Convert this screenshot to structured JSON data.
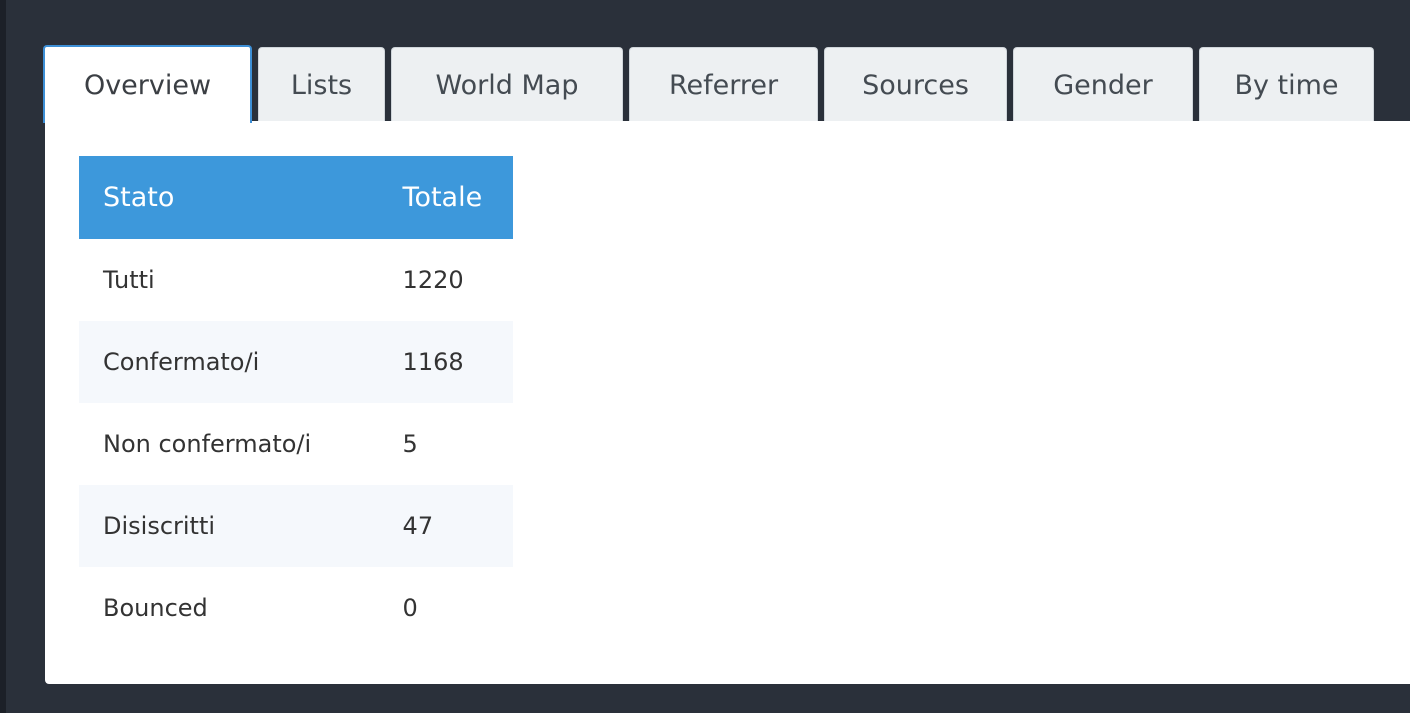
{
  "tabs": [
    {
      "label": "Overview",
      "active": true
    },
    {
      "label": "Lists",
      "active": false
    },
    {
      "label": "World Map",
      "active": false
    },
    {
      "label": "Referrer",
      "active": false
    },
    {
      "label": "Sources",
      "active": false
    },
    {
      "label": "Gender",
      "active": false
    },
    {
      "label": "By time",
      "active": false
    }
  ],
  "table": {
    "headers": [
      "Stato",
      "Totale"
    ],
    "rows": [
      {
        "status": "Tutti",
        "total": "1220"
      },
      {
        "status": "Confermato/i",
        "total": "1168"
      },
      {
        "status": "Non confermato/i",
        "total": "5"
      },
      {
        "status": "Disiscritti",
        "total": "47"
      },
      {
        "status": "Bounced",
        "total": "0"
      }
    ]
  },
  "colors": {
    "background": "#2a303a",
    "accent": "#3d98db",
    "tab_bg": "#edf0f2",
    "active_border": "#3d8fd6",
    "alt_row": "#f5f8fc"
  }
}
